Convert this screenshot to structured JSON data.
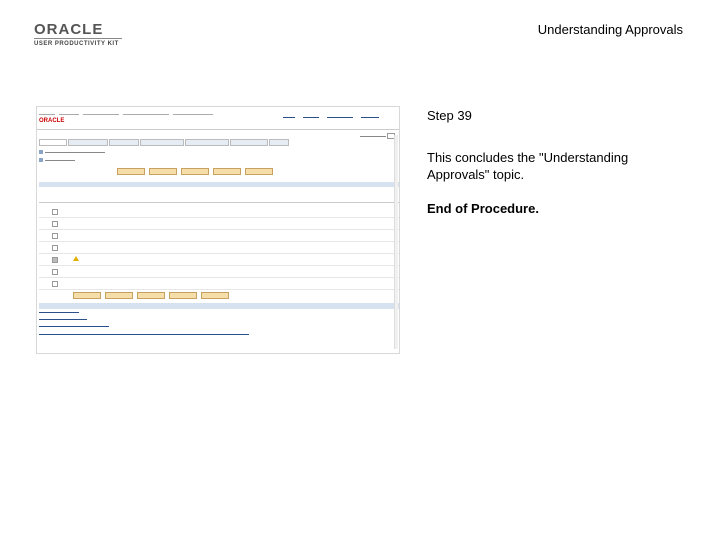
{
  "header": {
    "logo_text": "ORACLE",
    "logo_subtext": "USER PRODUCTIVITY KIT",
    "title": "Understanding Approvals"
  },
  "step": {
    "label": "Step 39",
    "description": "This concludes the \"Understanding Approvals\" topic.",
    "end_text": "End of Procedure."
  },
  "screenshot": {
    "app_logo": "ORACLE"
  },
  "colors": {
    "accent": "#2a4f8a",
    "brand": "#cc0000",
    "button": "#f6deaa"
  }
}
